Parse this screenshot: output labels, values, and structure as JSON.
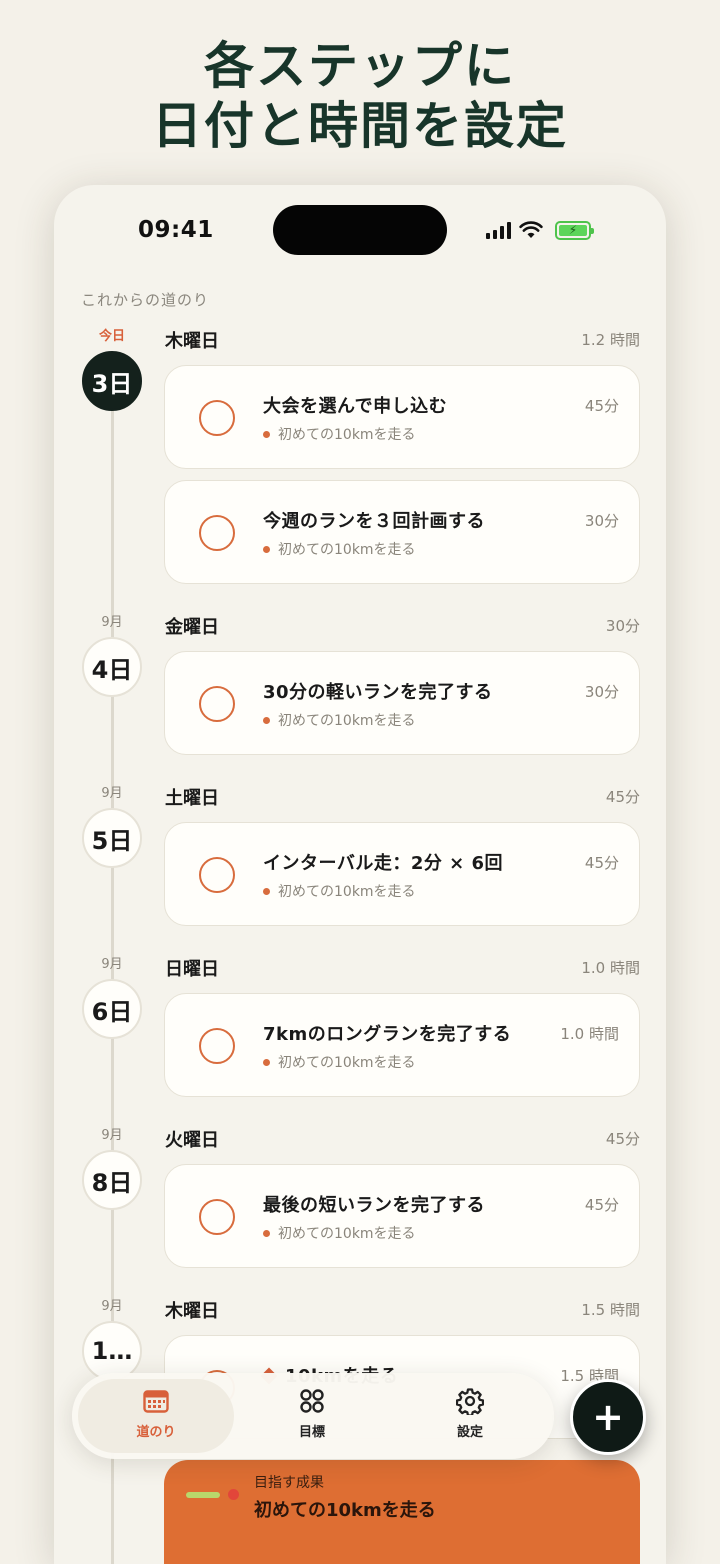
{
  "headline": {
    "line1": "各ステップに",
    "line2": "日付と時間を設定"
  },
  "status_bar": {
    "time": "09:41",
    "battery_color": "#5dd55a"
  },
  "section_label": "これからの道のり",
  "days": [
    {
      "month": "今日",
      "date": "3日",
      "weekday": "木曜日",
      "total": "1.2 時間",
      "tasks": [
        {
          "title": "大会を選んで申し込む",
          "goal": "初めての10kmを走る",
          "duration": "45分"
        },
        {
          "title": "今週のランを３回計画する",
          "goal": "初めての10kmを走る",
          "duration": "30分"
        }
      ]
    },
    {
      "month": "9月",
      "date": "4日",
      "weekday": "金曜日",
      "total": "30分",
      "tasks": [
        {
          "title": "30分の軽いランを完了する",
          "goal": "初めての10kmを走る",
          "duration": "30分"
        }
      ]
    },
    {
      "month": "9月",
      "date": "5日",
      "weekday": "土曜日",
      "total": "45分",
      "tasks": [
        {
          "title": "インターバル走：2分 × 6回",
          "goal": "初めての10kmを走る",
          "duration": "45分"
        }
      ]
    },
    {
      "month": "9月",
      "date": "6日",
      "weekday": "日曜日",
      "total": "1.0 時間",
      "tasks": [
        {
          "title": "7kmのロングランを完了する",
          "goal": "初めての10kmを走る",
          "duration": "1.0 時間"
        }
      ]
    },
    {
      "month": "9月",
      "date": "8日",
      "weekday": "火曜日",
      "total": "45分",
      "tasks": [
        {
          "title": "最後の短いランを完了する",
          "goal": "初めての10kmを走る",
          "duration": "45分"
        }
      ]
    },
    {
      "month": "9月",
      "date": "1…",
      "weekday": "木曜日",
      "total": "1.5 時間",
      "tasks": [
        {
          "title": "10kmを走る",
          "duration": "1.5 時間"
        }
      ]
    }
  ],
  "tabbar": {
    "tabs": [
      {
        "label": "道のり",
        "icon": "calendar-icon",
        "active": true
      },
      {
        "label": "目標",
        "icon": "grid-icon",
        "active": false
      },
      {
        "label": "設定",
        "icon": "gear-icon",
        "active": false
      }
    ]
  },
  "fab": {
    "label": "+"
  },
  "goal_card": {
    "label": "目指す成果",
    "value": "初めての10kmを走る"
  },
  "colors": {
    "accent": "#d8603a",
    "headline": "#18352a",
    "dark": "#14211c",
    "goal_card": "#de6e33"
  }
}
